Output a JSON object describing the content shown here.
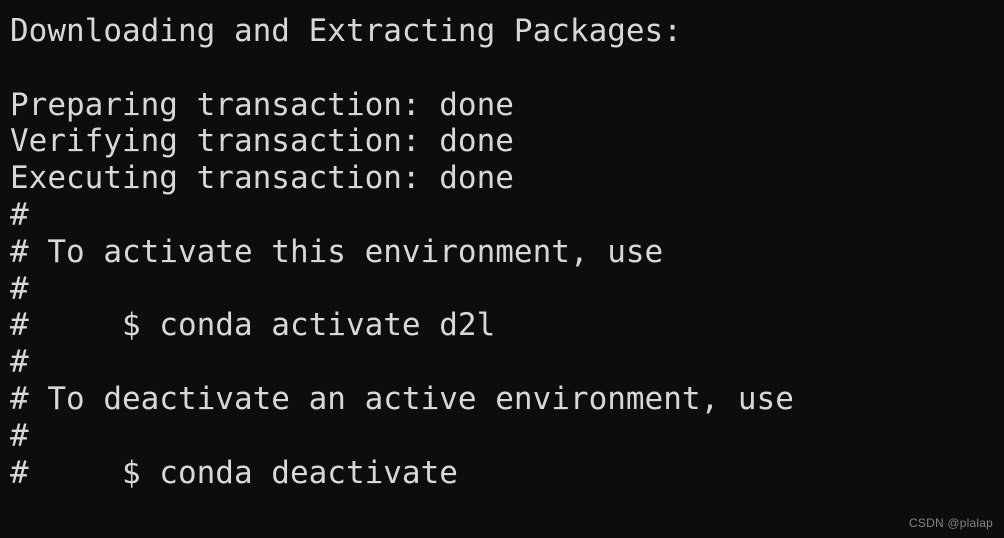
{
  "terminal": {
    "background_color": "#0d0d0d",
    "text_color": "#d8d8d8",
    "lines": [
      "Downloading and Extracting Packages:",
      "",
      "Preparing transaction: done",
      "Verifying transaction: done",
      "Executing transaction: done",
      "#",
      "# To activate this environment, use",
      "#",
      "#     $ conda activate d2l",
      "#",
      "# To deactivate an active environment, use",
      "#",
      "#     $ conda deactivate",
      ""
    ]
  },
  "watermark": {
    "text": "CSDN @plalap",
    "color": "#85858a"
  }
}
